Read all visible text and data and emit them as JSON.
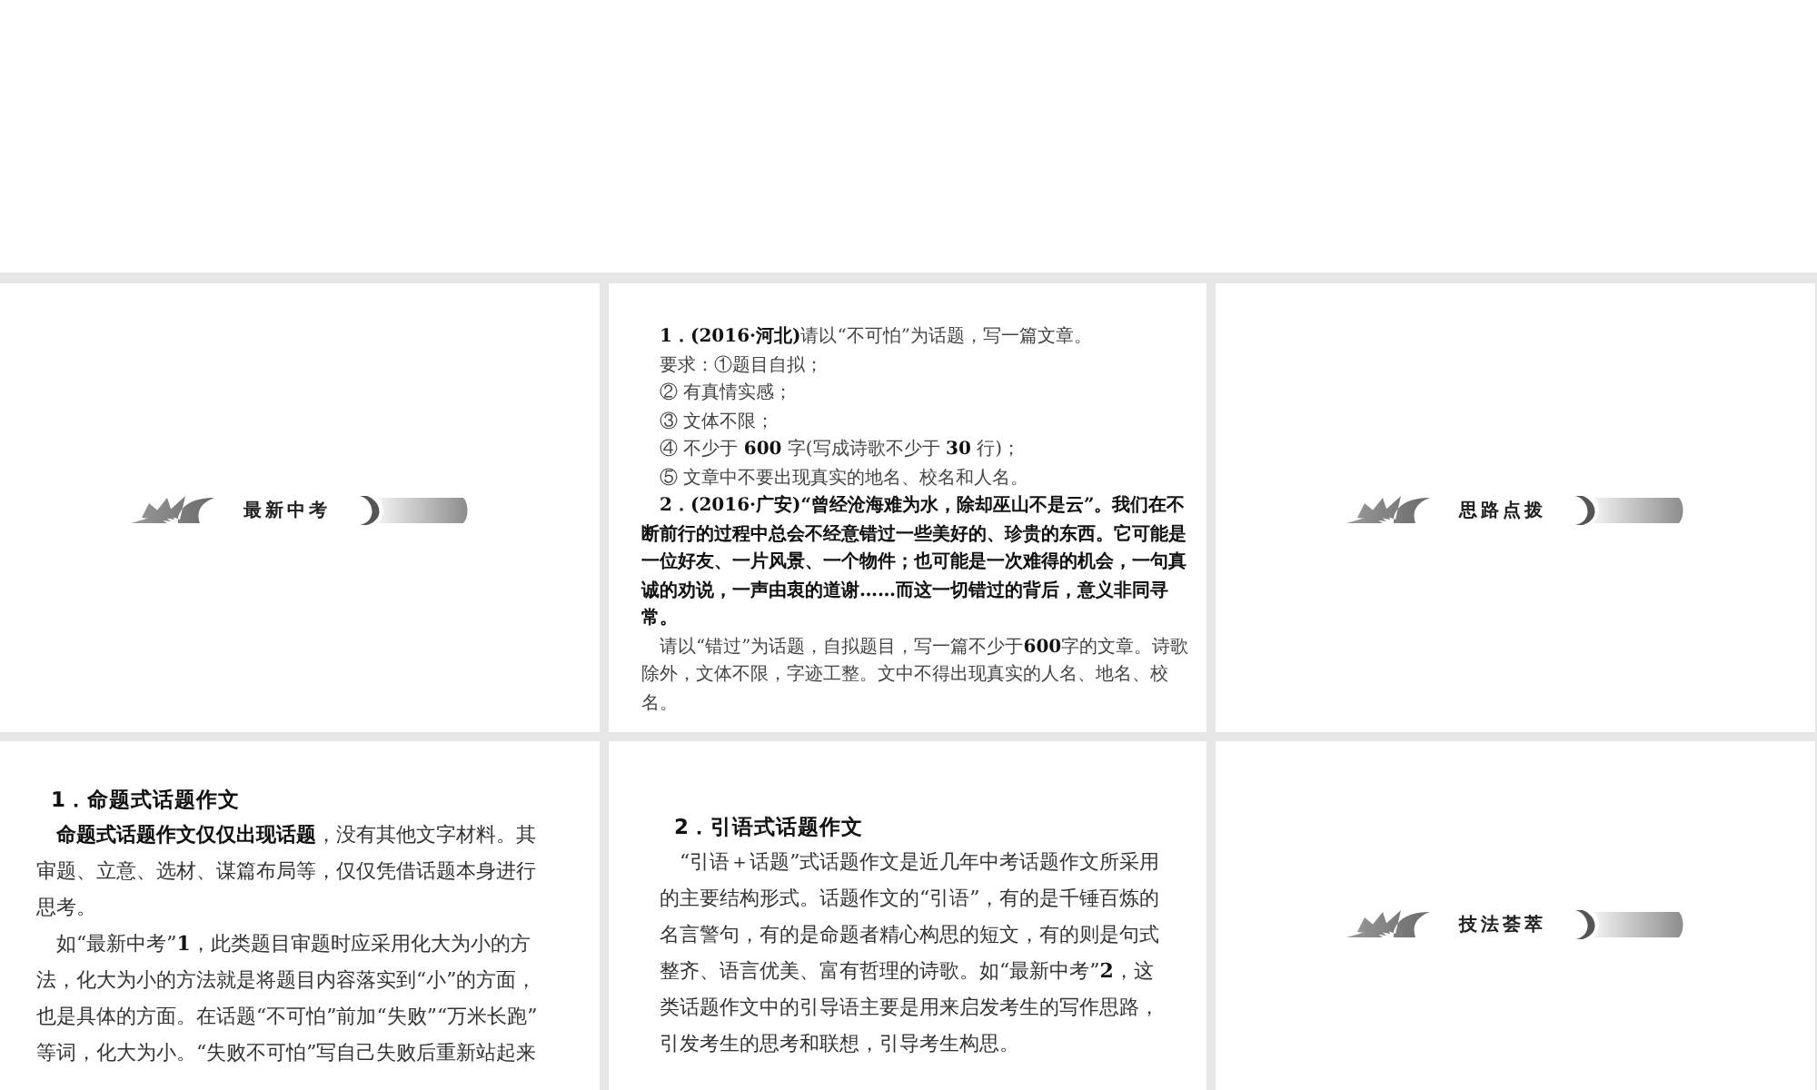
{
  "slides": [
    {
      "kind": "banner",
      "title": "最新中考"
    },
    {
      "kind": "questions",
      "items": [
        {
          "kind": "para",
          "lines": [
            "**1．(2016·河北)**请以“不可怕”为话题，写一篇文章。"
          ]
        },
        {
          "kind": "para",
          "lines": [
            "要求：①题目自拟；"
          ]
        },
        {
          "kind": "para",
          "lines": [
            "② 有真情实感；"
          ]
        },
        {
          "kind": "para",
          "lines": [
            "③ 文体不限；"
          ]
        },
        {
          "kind": "para",
          "lines": [
            "④ 不少于 **600** 字(写成诗歌不少于 **30** 行)；"
          ]
        },
        {
          "kind": "para",
          "lines": [
            "⑤ 文章中不要出现真实的地名、校名和人名。"
          ]
        },
        {
          "kind": "para",
          "bold": true,
          "lines": [
            "2．(2016·广安)“曾经沧海难为水，除却巫山不是云”。我们在不断前行的过程中总会不经意错过一些美好的、珍贵的东西。它可能是一位好友、一片风景、一个物件；也可能是一次难得的机会，一句真诚的劝说，一声由衷的道谢……而这一切错过的背后，意义非同寻常。"
          ]
        },
        {
          "kind": "para",
          "lines": [
            "请以“错过”为话题，自拟题目，写一篇不少于**600**字的文章。诗歌除外，文体不限，字迹工整。文中不得出现真实的人名、地名、校名。"
          ]
        }
      ]
    },
    {
      "kind": "banner",
      "title": "思路点拨"
    },
    {
      "kind": "notes",
      "items": [
        {
          "kind": "heading",
          "lines": [
            "1．命题式话题作文"
          ]
        },
        {
          "kind": "para",
          "lines": [
            "**命题式话题作文仅仅出现话题**，没有其他文字材料。其",
            "审题、立意、选材、谋篇布局等，仅仅凭借话题本身进行",
            "思考。"
          ]
        },
        {
          "kind": "para",
          "lines": [
            "如“最新中考”**1**，此类题目审题时应采用化大为小的方",
            "法，化大为小的方法就是将题目内容落实到“小”的方面，",
            "也是具体的方面。在话题“不可怕”前加“失败”“万米长跑”",
            "等词，化大为小。“失败不可怕”写自己失败后重新站起来"
          ]
        }
      ]
    },
    {
      "kind": "notes",
      "items": [
        {
          "kind": "heading",
          "lines": [
            "2．引语式话题作文"
          ]
        },
        {
          "kind": "para",
          "lines": [
            "“引语＋话题”式话题作文是近几年中考话题作文所采用",
            "的主要结构形式。话题作文的“引语”，有的是千锤百炼的",
            "名言警句，有的是命题者精心构思的短文，有的则是句式",
            "整齐、语言优美、富有哲理的诗歌。如“最新中考”**2**，这",
            "类话题作文中的引导语主要是用来启发考生的写作思路，",
            "引发考生的思考和联想，引导考生构思。"
          ]
        }
      ]
    },
    {
      "kind": "banner",
      "title": "技法荟萃"
    }
  ]
}
